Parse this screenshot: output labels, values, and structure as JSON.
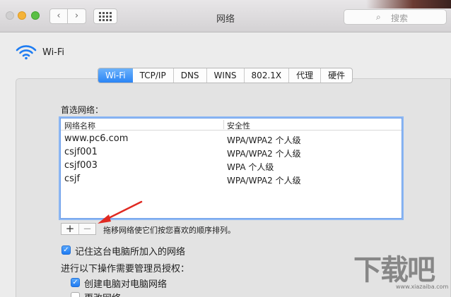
{
  "window": {
    "title": "网络"
  },
  "search": {
    "placeholder": "搜索",
    "icon": "search-icon"
  },
  "toolbar": {
    "back_icon": "chevron-left-icon",
    "forward_icon": "chevron-right-icon",
    "grid_icon": "grid-icon"
  },
  "header": {
    "label": "Wi-Fi",
    "icon": "wifi-icon"
  },
  "tabs": [
    {
      "label": "Wi-Fi",
      "active": true
    },
    {
      "label": "TCP/IP",
      "active": false
    },
    {
      "label": "DNS",
      "active": false
    },
    {
      "label": "WINS",
      "active": false
    },
    {
      "label": "802.1X",
      "active": false
    },
    {
      "label": "代理",
      "active": false
    },
    {
      "label": "硬件",
      "active": false
    }
  ],
  "preferred": {
    "title": "首选网络：",
    "columns": [
      "网络名称",
      "安全性"
    ],
    "rows": [
      {
        "name": "www.pc6.com",
        "security": "WPA/WPA2 个人级"
      },
      {
        "name": "csjf001",
        "security": "WPA/WPA2 个人级"
      },
      {
        "name": "csjf003",
        "security": "WPA 个人级"
      },
      {
        "name": "csjf",
        "security": "WPA/WPA2 个人级"
      }
    ],
    "add_label": "+",
    "remove_label": "−",
    "hint": "拖移网络使它们按您喜欢的顺序排列。"
  },
  "options": {
    "remember": {
      "label": "记住这台电脑所加入的网络",
      "checked": true
    },
    "admin_title": "进行以下操作需要管理员授权：",
    "create": {
      "label": "创建电脑对电脑网络",
      "checked": true
    },
    "change": {
      "label": "更改网络",
      "checked": false
    }
  },
  "watermark": {
    "text": "下载吧",
    "url": "www.xiazaiba.com"
  },
  "colors": {
    "accent": "#2b85f5",
    "arrow": "#e02a22"
  }
}
